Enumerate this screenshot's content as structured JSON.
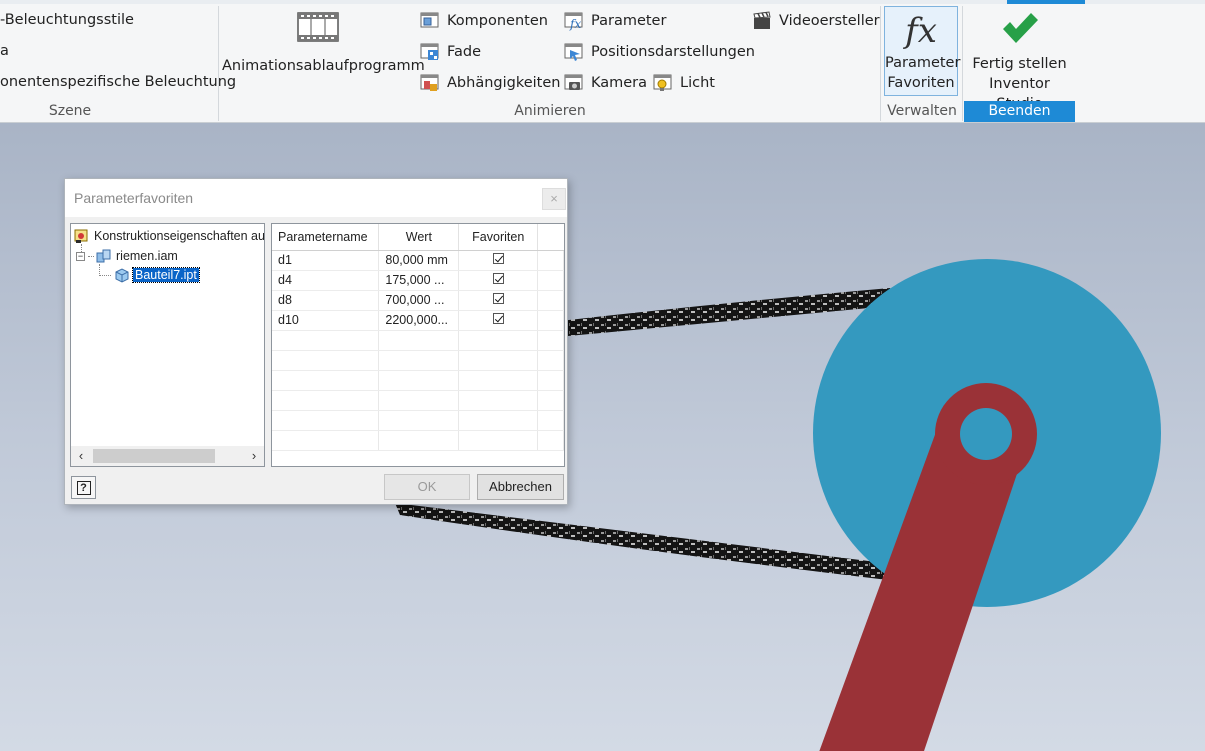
{
  "ribbon": {
    "szene": {
      "items": [
        "-Beleuchtungsstile",
        "a",
        "onentenspezifische Beleuchtung"
      ],
      "label": "Szene"
    },
    "animieren": {
      "animationsablaufprogramm": "Animationsablaufprogramm",
      "komponenten": "Komponenten",
      "fade": "Fade",
      "abhaengigkeiten": "Abhängigkeiten",
      "parameter": "Parameter",
      "positionsdarstellungen": "Positionsdarstellungen",
      "kamera": "Kamera",
      "licht": "Licht",
      "videoersteller": "Videoersteller",
      "label": "Animieren"
    },
    "verwalten": {
      "fx_glyph": "fx",
      "button_line1": "Parameter",
      "button_line2": "Favoriten",
      "label": "Verwalten"
    },
    "beenden": {
      "button_line1": "Fertig stellen",
      "button_line2": "Inventor Studio",
      "label": "Beenden"
    }
  },
  "dialog": {
    "title": "Parameterfavoriten",
    "close_glyph": "×",
    "tree": {
      "root": "Konstruktionseigenschaften au",
      "assembly": "riemen.iam",
      "part": "Bauteil7.ipt"
    },
    "grid": {
      "columns": [
        "Parametername",
        "Wert",
        "Favoriten"
      ],
      "rows": [
        {
          "name": "d1",
          "value": "80,000 mm",
          "favorite": true
        },
        {
          "name": "d4",
          "value": "175,000 ...",
          "favorite": true
        },
        {
          "name": "d8",
          "value": "700,000 ...",
          "favorite": true
        },
        {
          "name": "d10",
          "value": "2200,000...",
          "favorite": true
        }
      ]
    },
    "ok_label": "OK",
    "cancel_label": "Abbrechen",
    "help_glyph": "?"
  },
  "colors": {
    "accent": "#1e8ad6",
    "pulley": "#3499bf",
    "crank": "#9a3237",
    "selection": "#0a64c8"
  },
  "icons": [
    "film-icon",
    "components-icon",
    "fade-icon",
    "constraints-icon",
    "parameter-icon",
    "positional-representations-icon",
    "camera-icon",
    "light-icon",
    "clapperboard-icon",
    "fx-icon",
    "checkmark-icon",
    "help-icon"
  ]
}
